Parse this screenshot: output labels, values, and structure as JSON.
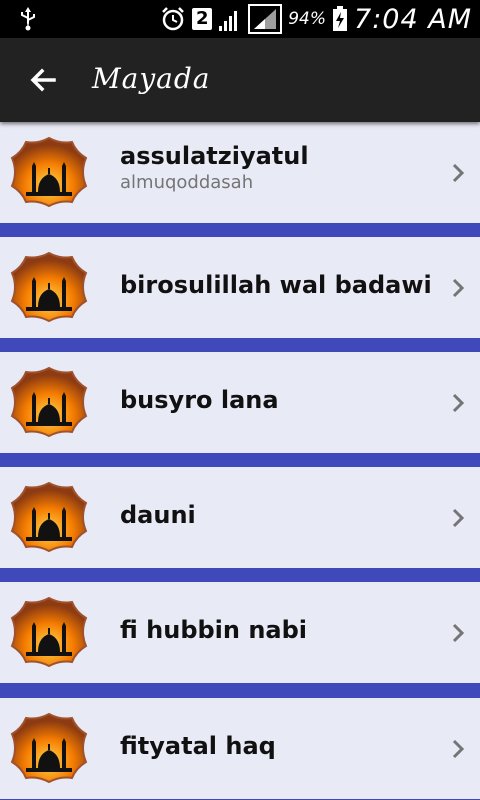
{
  "status_bar": {
    "notification_count": "2",
    "battery": "94%",
    "time": "7:04 AM"
  },
  "app_bar": {
    "title": "Mayada"
  },
  "list": {
    "items": [
      {
        "title": "assulatziyatul",
        "subtitle": "almuqoddasah"
      },
      {
        "title": "birosulillah wal badawi",
        "subtitle": ""
      },
      {
        "title": "busyro lana",
        "subtitle": ""
      },
      {
        "title": "dauni",
        "subtitle": ""
      },
      {
        "title": "fi hubbin nabi",
        "subtitle": ""
      },
      {
        "title": "fityatal haq",
        "subtitle": ""
      }
    ]
  },
  "colors": {
    "divider": "#3f49b9",
    "row_bg": "#e8eaf6",
    "appbar_bg": "#222222"
  }
}
